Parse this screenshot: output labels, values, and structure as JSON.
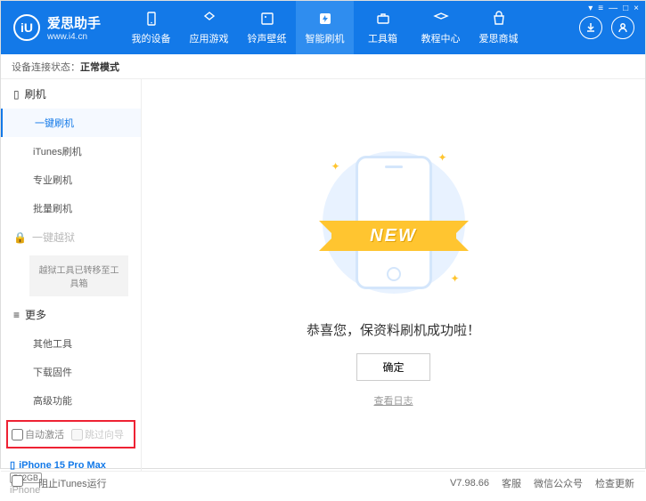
{
  "logo": {
    "icon_text": "iU",
    "title": "爱思助手",
    "subtitle": "www.i4.cn"
  },
  "window_controls": [
    "▾",
    "≡",
    "—",
    "□",
    "×"
  ],
  "nav": [
    {
      "label": "我的设备"
    },
    {
      "label": "应用游戏"
    },
    {
      "label": "铃声壁纸"
    },
    {
      "label": "智能刷机",
      "active": true
    },
    {
      "label": "工具箱"
    },
    {
      "label": "教程中心"
    },
    {
      "label": "爱思商城"
    }
  ],
  "status": {
    "prefix": "设备连接状态：",
    "mode": "正常模式"
  },
  "sidebar": {
    "group_flash": "刷机",
    "items_flash": [
      "一键刷机",
      "iTunes刷机",
      "专业刷机",
      "批量刷机"
    ],
    "group_jail_label": "一键越狱",
    "jail_note": "越狱工具已转移至工具箱",
    "group_more": "更多",
    "items_more": [
      "其他工具",
      "下载固件",
      "高级功能"
    ],
    "checkbox1": "自动激活",
    "checkbox2": "跳过向导"
  },
  "device": {
    "name": "iPhone 15 Pro Max",
    "storage": "512GB",
    "type": "iPhone"
  },
  "main": {
    "ribbon": "NEW",
    "success": "恭喜您，保资料刷机成功啦！",
    "ok": "确定",
    "log": "查看日志"
  },
  "footer": {
    "block_itunes": "阻止iTunes运行",
    "version": "V7.98.66",
    "links": [
      "客服",
      "微信公众号",
      "检查更新"
    ]
  }
}
